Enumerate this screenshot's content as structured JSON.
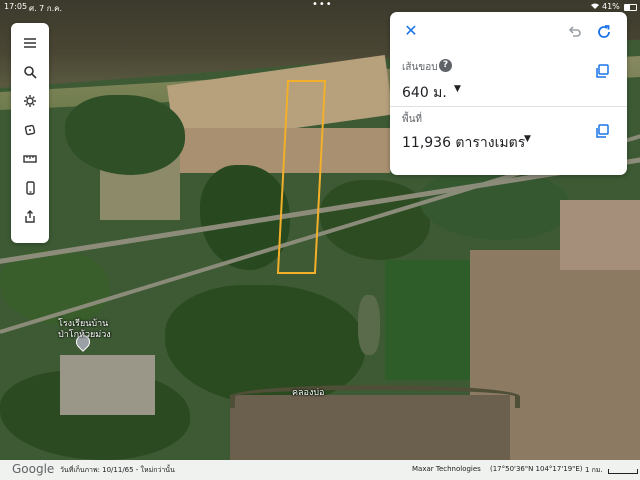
{
  "status_bar": {
    "time": "17:05",
    "date": "ศ. 7 ก.ค.",
    "dots": "•••",
    "battery_percent": "41%",
    "battery_level": 0.41
  },
  "toolbar": {
    "items": [
      {
        "icon": "menu-icon"
      },
      {
        "icon": "search-icon"
      },
      {
        "icon": "settings-gear-icon"
      },
      {
        "icon": "cube-3d-icon"
      },
      {
        "icon": "ruler-icon"
      },
      {
        "icon": "phone-icon"
      },
      {
        "icon": "share-icon"
      }
    ]
  },
  "measure_panel": {
    "close_icon": "close-icon",
    "undo_icon": "undo-icon",
    "redo_icon": "redo-icon",
    "perimeter_label": "เส้นขอบ",
    "help": "?",
    "perimeter_value": "640 ม.",
    "area_label": "พื้นที่",
    "area_value": "11,936 ตารางเมตร",
    "dropdown": "▼",
    "copy_icon": "copy-icon"
  },
  "map_labels": {
    "school_line1": "โรงเรียนบ้าน",
    "school_line2": "ป่าโกห้วยม่วง",
    "canal": "คลองบ่อ"
  },
  "footer": {
    "logo": "Google",
    "imagery_date": "วันที่เก็บภาพ: 10/11/65 - ใหม่กว่านั้น",
    "attribution": "Maxar Technologies",
    "coordinates": "(17°50'36\"N 104°17'19\"E)",
    "scale": "1 กม."
  },
  "colors": {
    "accent": "#1a73e8",
    "plot_outline": "#f2b02a"
  }
}
